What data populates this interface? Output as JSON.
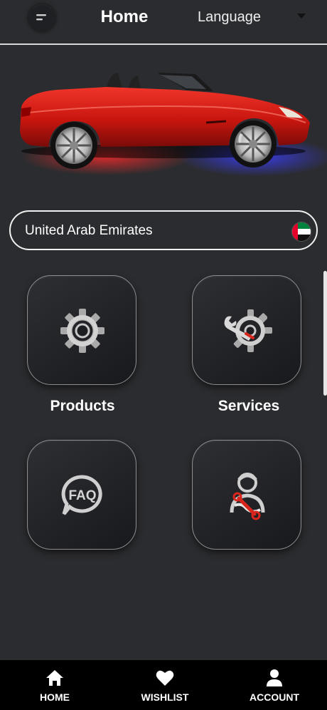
{
  "header": {
    "title": "Home",
    "language_label": "Language",
    "menu_icon": "menu-icon",
    "caret_icon": "caret-down-icon"
  },
  "hero": {
    "image": "red-convertible-sports-car"
  },
  "country_selector": {
    "value": "United Arab Emirates",
    "flag_icon": "uae-flag-icon"
  },
  "tiles": [
    {
      "label": "Products",
      "icon": "gear-icon"
    },
    {
      "label": "Services",
      "icon": "wrench-gear-icon"
    },
    {
      "label": "",
      "icon": "faq-icon"
    },
    {
      "label": "",
      "icon": "mechanic-icon"
    }
  ],
  "bottom_nav": [
    {
      "label": "HOME",
      "icon": "home-icon"
    },
    {
      "label": "WISHLIST",
      "icon": "heart-icon"
    },
    {
      "label": "ACCOUNT",
      "icon": "account-icon"
    }
  ],
  "colors": {
    "background": "#2b2c2f",
    "nav_background": "#000000",
    "accent_red": "#d9261c"
  }
}
